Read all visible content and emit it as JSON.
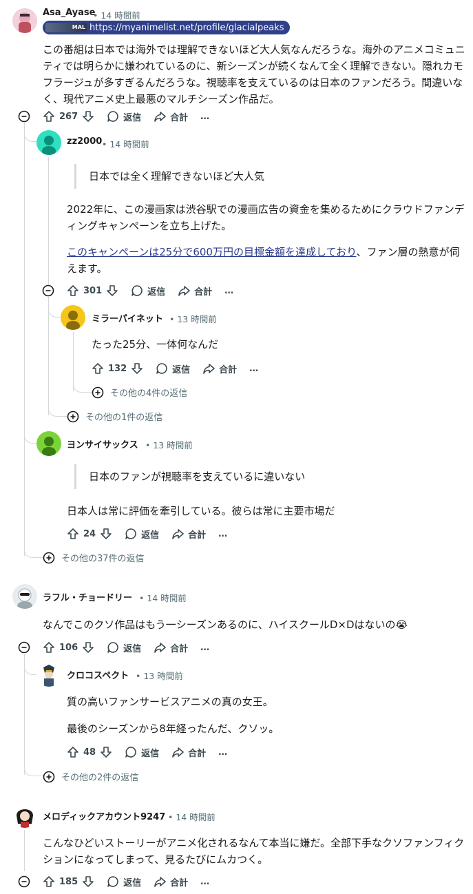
{
  "comments": {
    "c1": {
      "username": "Asa_Ayase",
      "time": "• 14 時間前",
      "flair_badge": "MAL",
      "flair_text": "https://myanimelist.net/profile/glacialpeaks",
      "body": "この番組は日本では海外では理解できないほど大人気なんだろうな。海外のアニメコミュニティでは明らかに嫌われているのに、新シーズンが続くなんて全く理解できない。隠れカモフラージュが多すぎるんだろうな。視聴率を支えているのは日本のファンだろう。間違いなく、現代アニメ史上最悪のマルチシーズン作品だ。",
      "votes": "267"
    },
    "c1r1": {
      "username": "zz2000",
      "time": "• 14 時間前",
      "quote": "日本では全く理解できないほど大人気",
      "body1": "2022年に、この漫画家は渋谷駅での漫画広告の資金を集めるためにクラウドファンディングキャンペーンを立ち上げた。",
      "link": "このキャンペーンは25分で600万円の目標金額を達成しており",
      "body2_suffix": "、ファン層の熱意が伺えます。",
      "votes": "301"
    },
    "c1r1r1": {
      "username": "ミラーパイネット",
      "time": "• 13 時間前",
      "body": "たった25分、一体何なんだ",
      "votes": "132",
      "more_replies": "その他の4件の返信"
    },
    "c1r1_more": "その他の1件の返信",
    "c1r2": {
      "username": "ヨンサイサックス",
      "time": "• 13 時間前",
      "quote": "日本のファンが視聴率を支えているに違いない",
      "body": "日本人は常に評価を牽引している。彼らは常に主要市場だ",
      "votes": "24"
    },
    "c1_more": "その他の37件の返信",
    "c2": {
      "username": "ラフル・チョードリー",
      "time": "• 14 時間前",
      "body": "なんでこのクソ作品はもう一シーズンあるのに、ハイスクールD×Dはないの😭",
      "votes": "106"
    },
    "c2r1": {
      "username": "クロコスペクト",
      "time": "• 13 時間前",
      "body1": "質の高いファンサービスアニメの真の女王。",
      "body2": "最後のシーズンから8年経ったんだ、クソッ。",
      "votes": "48"
    },
    "c2_more": "その他の2件の返信",
    "c3": {
      "username": "メロディックアカウント9247",
      "time": "• 14 時間前",
      "body": "こんなひどいストーリーがアニメ化されるなんて本当に嫌だ。全部下手なクソファンフィクションになってしまって、見るたびにムカつく。",
      "votes": "185"
    }
  },
  "labels": {
    "reply": "返信",
    "share": "合計",
    "more": "…"
  },
  "colors": {
    "meta_gray": "#576f76",
    "thread_line": "#d5d8da",
    "flair_bg": "#303f8a",
    "link": "#2b3a8a"
  }
}
